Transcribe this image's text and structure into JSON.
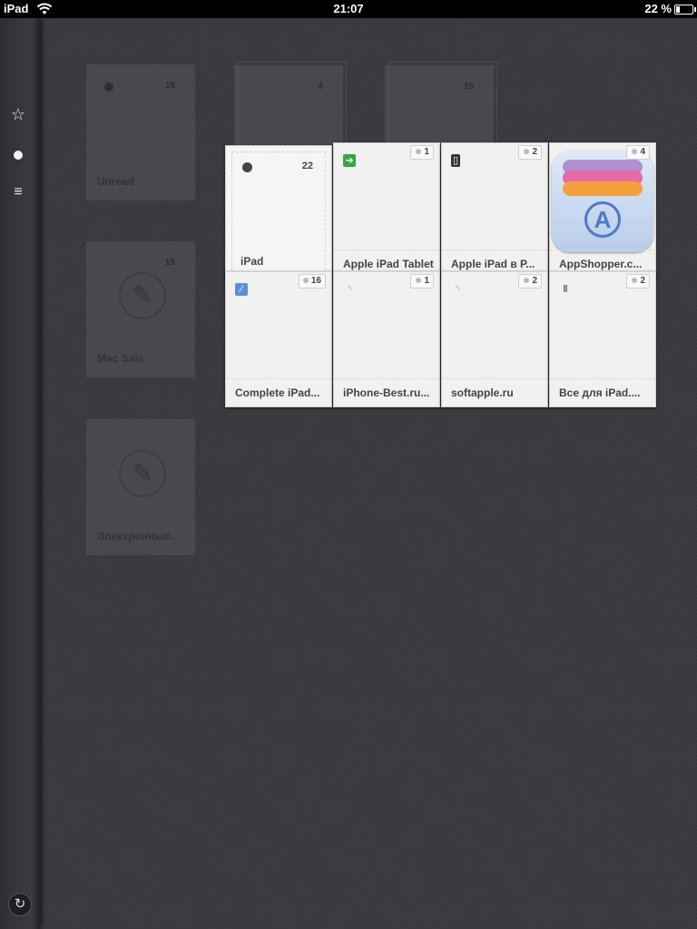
{
  "status_bar": {
    "device": "iPad",
    "time": "21:07",
    "battery_percent": "22 %",
    "battery_level": 0.22
  },
  "sidebar": {
    "items": [
      {
        "icon": "star-icon",
        "glyph": "☆"
      },
      {
        "icon": "dot-icon",
        "glyph": ""
      },
      {
        "icon": "list-icon",
        "glyph": "≡"
      }
    ],
    "refresh_glyph": "↻"
  },
  "background_folders": [
    {
      "label": "Unread",
      "count": "16"
    },
    {
      "label": "",
      "count": "4"
    },
    {
      "label": "",
      "count": "15"
    },
    {
      "label": "Mac Sale",
      "count": "15"
    },
    {
      "label": "Электронные..."
    }
  ],
  "open_folder": {
    "title": "iPad",
    "count": "22"
  },
  "feeds": [
    {
      "label": "Apple iPad Tablet",
      "count": "1",
      "favicon": "arrow-icon",
      "glyph": "➔"
    },
    {
      "label": "Apple iPad в Р...",
      "count": "2",
      "favicon": "phone-icon",
      "glyph": "▯"
    },
    {
      "label": "AppShopper.c...",
      "count": "4",
      "favicon": "appshopper-icon",
      "glyph": "A"
    },
    {
      "label": "Complete iPad...",
      "count": "16",
      "favicon": "blue-icon",
      "glyph": "⁄"
    },
    {
      "label": "iPhone-Best.ru...",
      "count": "1",
      "favicon": "rss-icon",
      "glyph": "◝"
    },
    {
      "label": "softapple.ru",
      "count": "2",
      "favicon": "rss-icon",
      "glyph": "◝"
    },
    {
      "label": "Все для iPad....",
      "count": "2",
      "favicon": "bars-icon",
      "glyph": "ǁ"
    }
  ]
}
